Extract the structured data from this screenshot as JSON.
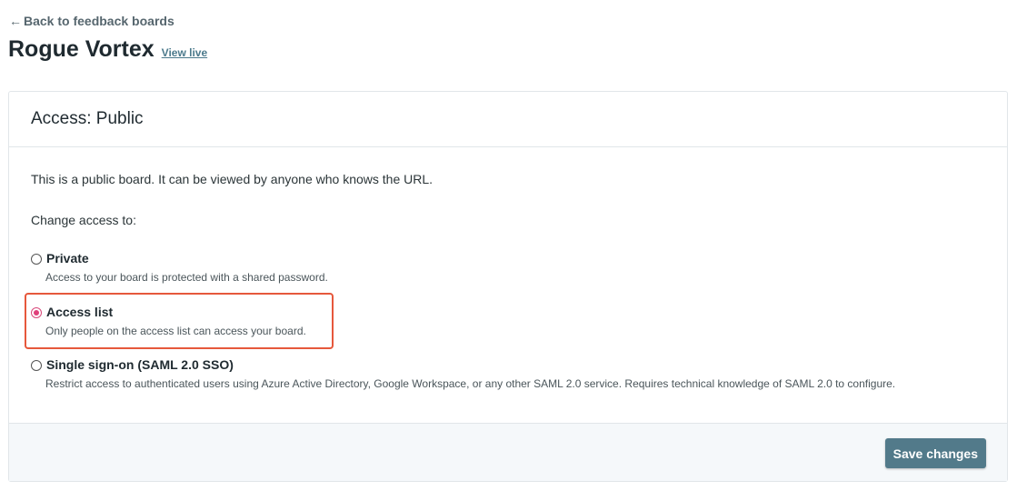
{
  "nav": {
    "back_label": "Back to feedback boards",
    "back_icon": "arrow-left-icon"
  },
  "board": {
    "title": "Rogue Vortex",
    "view_live_label": "View live"
  },
  "access": {
    "heading": "Access: Public",
    "description": "This is a public board. It can be viewed by anyone who knows the URL.",
    "change_label": "Change access to:",
    "selected": "access_list",
    "options": [
      {
        "id": "private",
        "label": "Private",
        "help": "Access to your board is protected with a shared password."
      },
      {
        "id": "access_list",
        "label": "Access list",
        "help": "Only people on the access list can access your board."
      },
      {
        "id": "sso",
        "label": "Single sign-on (SAML 2.0 SSO)",
        "help": "Restrict access to authenticated users using Azure Active Directory, Google Workspace, or any other SAML 2.0 service. Requires technical knowledge of SAML 2.0 to configure."
      }
    ],
    "save_label": "Save changes"
  },
  "colors": {
    "accent_radio": "#e0407a",
    "highlight_border": "#e6583c",
    "save_button": "#527a8a",
    "link": "#4c7a8c"
  }
}
